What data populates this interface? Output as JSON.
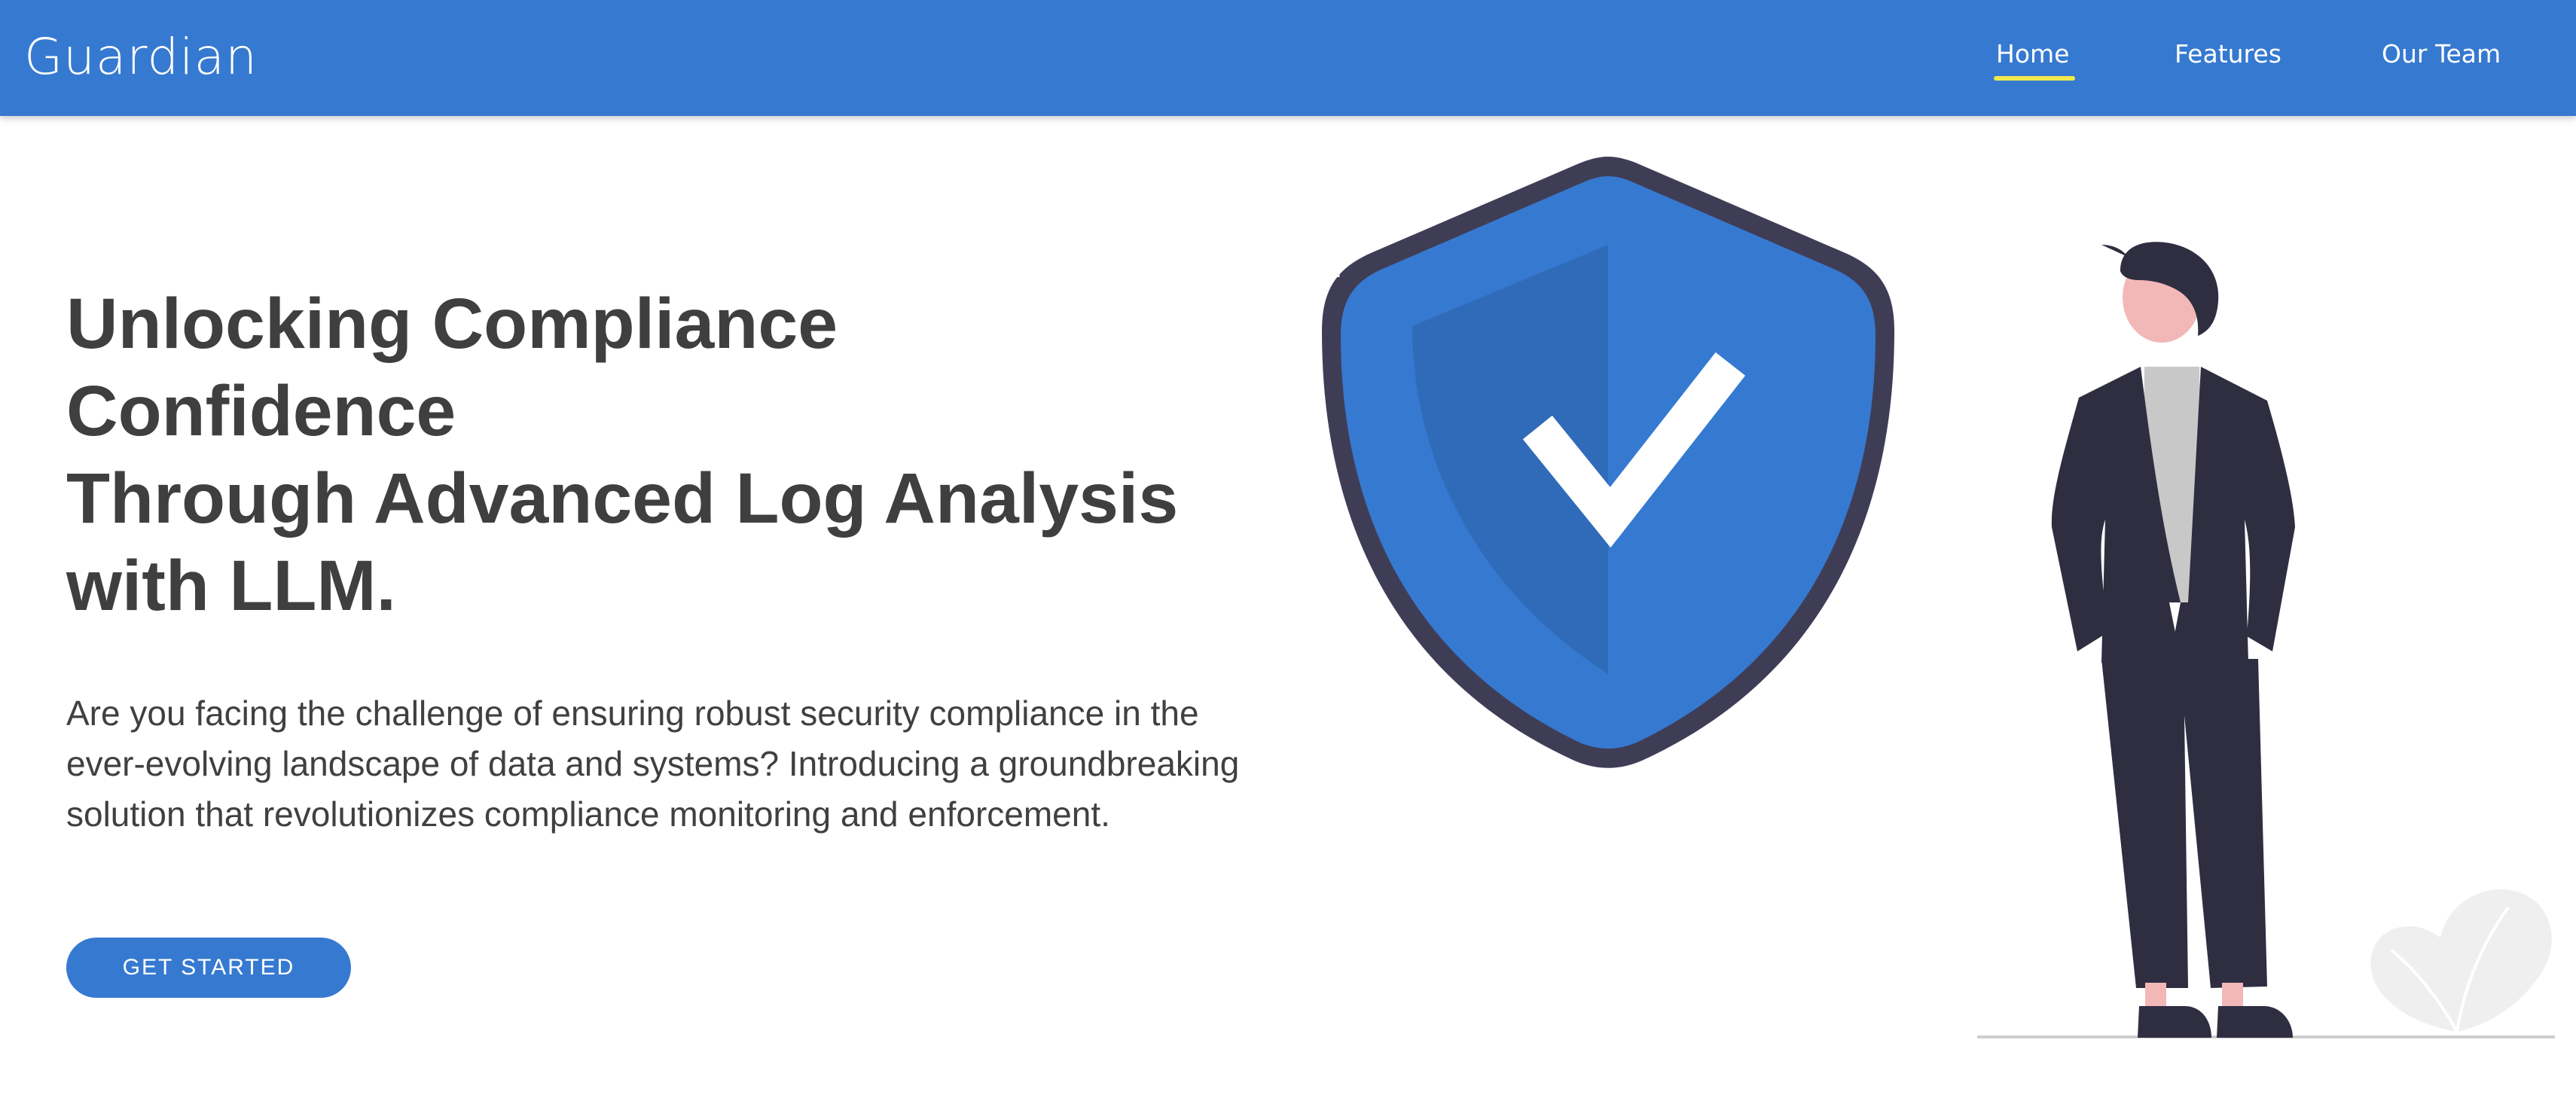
{
  "nav": {
    "brand": "Guardian",
    "links": [
      {
        "label": "Home",
        "active": true
      },
      {
        "label": "Features",
        "active": false
      },
      {
        "label": "Our Team",
        "active": false
      }
    ]
  },
  "hero": {
    "headline_lines": [
      "Unlocking Compliance",
      "Confidence",
      "Through Advanced Log Analysis",
      "with LLM."
    ],
    "intro": "Are you facing the challenge of ensuring robust security compliance in the ever-evolving landscape of data and systems? Introducing a groundbreaking solution that revolutionizes compliance monitoring and enforcement.",
    "cta_label": "GET STARTED"
  },
  "illustration": {
    "icons": [
      "shield-check-icon",
      "person-figure",
      "plant-leaf-icon"
    ]
  },
  "colors": {
    "brand_blue": "#3679d0",
    "nav_underline": "#f2e94e",
    "heading_text": "#3f3f3f",
    "shield_outline": "#3f3d56",
    "suit": "#2f2e41"
  }
}
